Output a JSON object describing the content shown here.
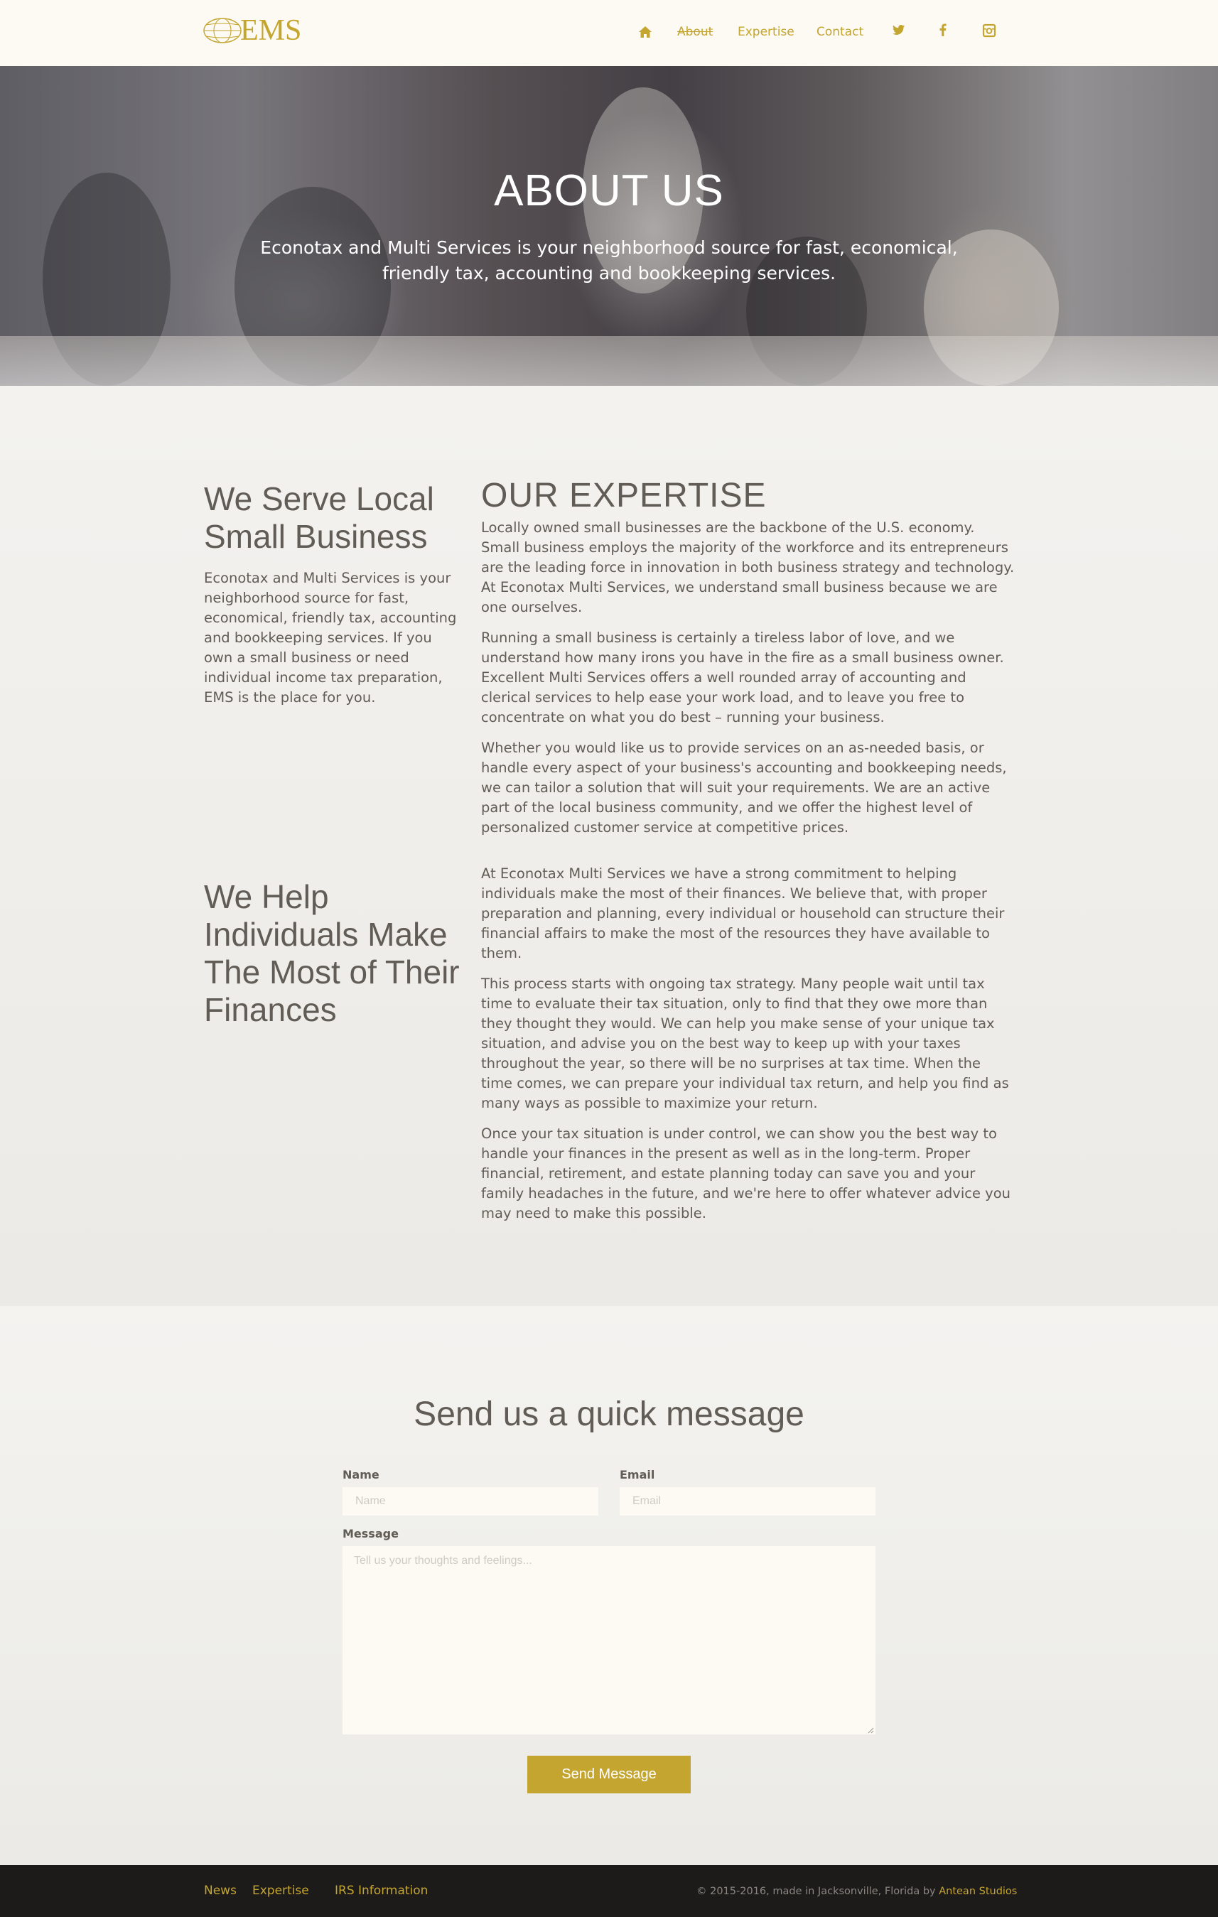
{
  "header": {
    "logo_text": "EMS",
    "nav": {
      "about": "About",
      "expertise": "Expertise",
      "contact": "Contact"
    },
    "icons": [
      "home-icon",
      "twitter-icon",
      "facebook-icon",
      "instagram-icon"
    ]
  },
  "hero": {
    "title": "ABOUT US",
    "subtitle": "Econotax and Multi Services is your neighborhood source for fast, economical, friendly tax, accounting and bookkeeping services."
  },
  "serve": {
    "heading": "We Serve Local Small Business",
    "text": "Econotax and Multi Services is your neighborhood source for fast, economical, friendly tax, accounting and bookkeeping services. If you own a small business or need individual income tax preparation, EMS is the place for you."
  },
  "expertise": {
    "heading": "OUR EXPERTISE",
    "paragraphs": [
      "Locally owned small businesses are the backbone of the U.S. economy. Small business employs the majority of the workforce and its entrepreneurs are the leading force in innovation in both business strategy and technology. At Econotax Multi Services, we understand small business because we are one ourselves.",
      "Running a small business is certainly a tireless labor of love, and we understand how many irons you have in the fire as a small business owner. Excellent Multi Services offers a well rounded array of accounting and clerical services to help ease your work load, and to leave you free to concentrate on what you do best – running your business.",
      "Whether you would like us to provide services on an as-needed basis, or handle every aspect of your business's accounting and bookkeeping needs, we can tailor a solution that will suit your requirements. We are an active part of the local business community, and we offer the highest level of personalized customer service at competitive prices."
    ]
  },
  "individuals": {
    "heading": "We Help Individuals Make The Most of Their Finances",
    "paragraphs": [
      "At Econotax Multi Services we have a strong commitment to helping individuals make the most of their finances. We believe that, with proper preparation and planning, every individual or household can structure their financial affairs to make the most of the resources they have available to them.",
      "This process starts with ongoing tax strategy. Many people wait until tax time to evaluate their tax situation, only to find that they owe more than they thought they would. We can help you make sense of your unique tax situation, and advise you on the best way to keep up with your taxes throughout the year, so there will be no surprises at tax time. When the time comes, we can prepare your individual tax return, and help you find as many ways as possible to maximize your return.",
      "Once your tax situation is under control, we can show you the best way to handle your finances in the present as well as in the long-term. Proper financial, retirement, and estate planning today can save you and your family headaches in the future, and we're here to offer whatever advice you may need to make this possible."
    ]
  },
  "contact": {
    "title": "Send us a quick message",
    "name_label": "Name",
    "name_placeholder": "Name",
    "email_label": "Email",
    "email_placeholder": "Email",
    "message_label": "Message",
    "message_placeholder": "Tell us your thoughts and feelings...",
    "send_label": "Send Message"
  },
  "footer": {
    "links": [
      "News",
      "Expertise",
      "IRS Information"
    ],
    "copyright": "© 2015-2016, made in Jacksonville, Florida by ",
    "studio": "Antean Studios"
  },
  "colors": {
    "accent": "#c4a530",
    "text": "#615c55",
    "header_bg": "#fcfaf3",
    "footer_bg": "#1c1b1a"
  }
}
